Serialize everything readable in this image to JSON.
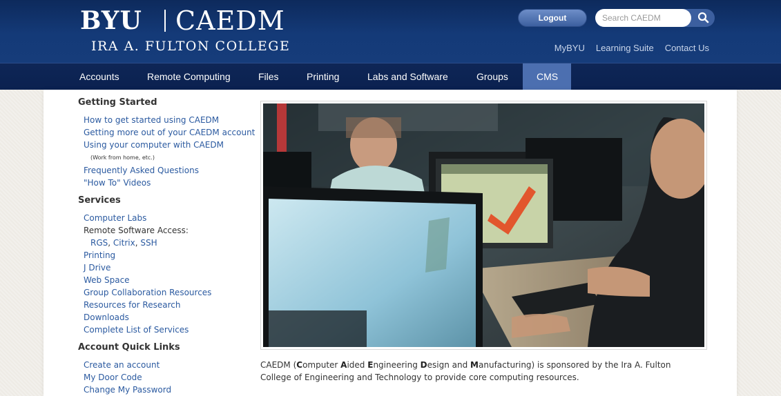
{
  "header": {
    "logo_byu": "BYU",
    "logo_caedm": "CAEDM",
    "logo_college": "IRA A. FULTON COLLEGE",
    "logout_label": "Logout",
    "search_placeholder": "Search CAEDM",
    "search_icon": "magnifier-icon",
    "top_links": [
      "MyBYU",
      "Learning Suite",
      "Contact Us"
    ]
  },
  "nav": {
    "items": [
      "Accounts",
      "Remote Computing",
      "Files",
      "Printing",
      "Labs and Software",
      "Groups",
      "CMS"
    ],
    "active": "CMS"
  },
  "sidebar": {
    "getting_started": {
      "heading": "Getting Started",
      "links": [
        "How to get started using CAEDM",
        "Getting more out of your CAEDM account",
        "Using your computer with CAEDM"
      ],
      "note": "(Work from home, etc.)",
      "links2": [
        "Frequently Asked Questions",
        "\"How To\" Videos"
      ]
    },
    "services": {
      "heading": "Services",
      "link_labs": "Computer Labs",
      "remote_access": "Remote Software Access:",
      "remote_links": [
        "RGS",
        "Citrix",
        "SSH"
      ],
      "links": [
        "Printing",
        "J Drive",
        "Web Space",
        "Group Collaboration Resources",
        "Resources for Research",
        "Downloads",
        "Complete List of Services"
      ]
    },
    "quick_links": {
      "heading": "Account Quick Links",
      "links": [
        "Create an account",
        "My Door Code",
        "Change My Password"
      ]
    }
  },
  "intro": {
    "part1": "CAEDM (",
    "c": "C",
    "omputer": "omputer ",
    "a": "A",
    "ided": "ided ",
    "e": "E",
    "ngineering": "ngineering ",
    "d": "D",
    "esign": "esign and ",
    "m": "M",
    "anufacturing": "anufacturing) is sponsored by the Ira A. Fulton College of Engineering and Technology to provide core computing resources."
  },
  "colors": {
    "header_blue": "#143a78",
    "nav_blue": "#0b2150",
    "nav_active": "#4c6fb0",
    "link_blue": "#2b5aa0"
  }
}
